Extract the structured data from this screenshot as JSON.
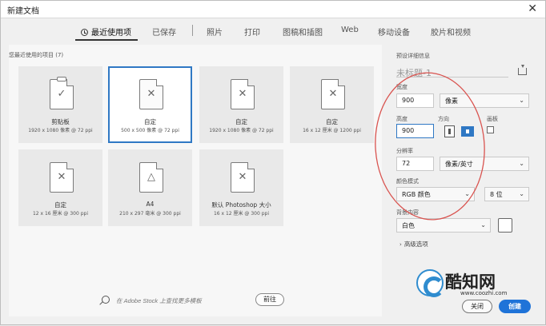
{
  "window": {
    "title": "新建文档",
    "close_glyph": "✕"
  },
  "tabs": [
    {
      "label": "最近使用项",
      "active": true
    },
    {
      "label": "已保存"
    },
    {
      "label": "照片"
    },
    {
      "label": "打印"
    },
    {
      "label": "图稿和插图"
    },
    {
      "label": "Web"
    },
    {
      "label": "移动设备"
    },
    {
      "label": "胶片和视频"
    }
  ],
  "recent": {
    "label": "您最近使用的项目",
    "count": "(7)",
    "items": [
      {
        "name": "剪贴板",
        "desc": "1920 x 1080 像素 @ 72 ppi",
        "icon": "clipboard-icon",
        "glyph": "✓"
      },
      {
        "name": "自定",
        "desc": "500 x 500 像素 @ 72 ppi",
        "icon": "custom-doc-icon",
        "glyph": "✕",
        "selected": true
      },
      {
        "name": "自定",
        "desc": "1920 x 1080 像素 @ 72 ppi",
        "icon": "custom-doc-icon",
        "glyph": "✕"
      },
      {
        "name": "自定",
        "desc": "16 x 12 厘米 @ 1200 ppi",
        "icon": "custom-doc-icon",
        "glyph": "✕"
      },
      {
        "name": "自定",
        "desc": "12 x 16 厘米 @ 300 ppi",
        "icon": "custom-doc-icon",
        "glyph": "✕"
      },
      {
        "name": "A4",
        "desc": "210 x 297 毫米 @ 300 ppi",
        "icon": "a4-shapes-icon",
        "glyph": "△"
      },
      {
        "name": "默认 Photoshop 大小",
        "desc": "16 x 12 厘米 @ 300 ppi",
        "icon": "custom-doc-icon",
        "glyph": "✕"
      }
    ]
  },
  "search": {
    "placeholder": "在 Adobe Stock 上查找更多模板",
    "go_label": "前往"
  },
  "details": {
    "section_label": "预设详细信息",
    "doc_name": "未标题-1",
    "width_label": "宽度",
    "width_value": "900",
    "width_unit": "像素",
    "height_label": "高度",
    "height_value": "900",
    "orientation_label": "方向",
    "artboard_label": "画板",
    "resolution_label": "分辨率",
    "resolution_value": "72",
    "resolution_unit": "像素/英寸",
    "color_mode_label": "颜色模式",
    "color_mode_value": "RGB 颜色",
    "bit_depth": "8 位",
    "bg_label": "背景内容",
    "bg_value": "白色",
    "advanced_label": "高级选项"
  },
  "buttons": {
    "close": "关闭",
    "create": "创建"
  },
  "watermark": {
    "text": "酷知网",
    "url": "www.coozhi.com"
  },
  "colors": {
    "accent": "#2f78c4",
    "create_button": "#1f73d8",
    "annotation": "#d9534f"
  }
}
